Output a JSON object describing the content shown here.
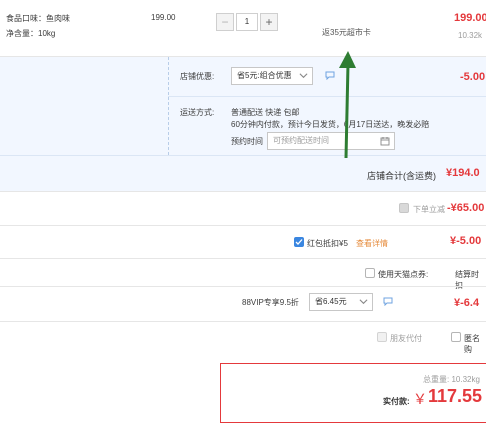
{
  "product": {
    "flavor": "食品口味：鱼肉味",
    "weight": "净含量：10kg",
    "unit_price": "199.00",
    "quantity": "1",
    "minus": "−",
    "plus": "+",
    "promo": "返35元超市卡",
    "total": "199.00",
    "total_weight": "10.32k"
  },
  "shop": {
    "discount_label": "店铺优惠:",
    "discount_value": "省5元:组合优惠",
    "discount_amount": "-5.00",
    "shipping_label": "运送方式:",
    "shipping_line1": "普通配送 快递 包邮",
    "shipping_line2": "60分钟内付款，预计今日发货，6月17日送达，晚发必赔",
    "schedule_label": "预约时间",
    "schedule_placeholder": "可预约配送时间",
    "subtotal_label": "店铺合计(含运费)",
    "subtotal_value": "¥194.0"
  },
  "order": {
    "instant_label": "下单立减",
    "instant_value": "-¥65.00",
    "redpacket_label": "红包抵扣¥5",
    "redpacket_link": "查看详情",
    "redpacket_value": "¥-5.00",
    "tmall_points_label": "使用天猫点券:",
    "tmall_points_right": "结算时扣",
    "vip_label": "88VIP专享9.5折",
    "vip_select": "省6.45元",
    "vip_value": "¥-6.4",
    "friend_pay": "朋友代付",
    "anonymous": "匿名购"
  },
  "summary": {
    "weight": "总重量: 10.32kg",
    "pay_label": "实付款:",
    "pay_currency": "￥",
    "pay_value": "117.55"
  },
  "colors": {
    "accent_red": "#e4393c",
    "arrow_green": "#2e7d32",
    "highlight_blue": "#f2f7ff"
  }
}
